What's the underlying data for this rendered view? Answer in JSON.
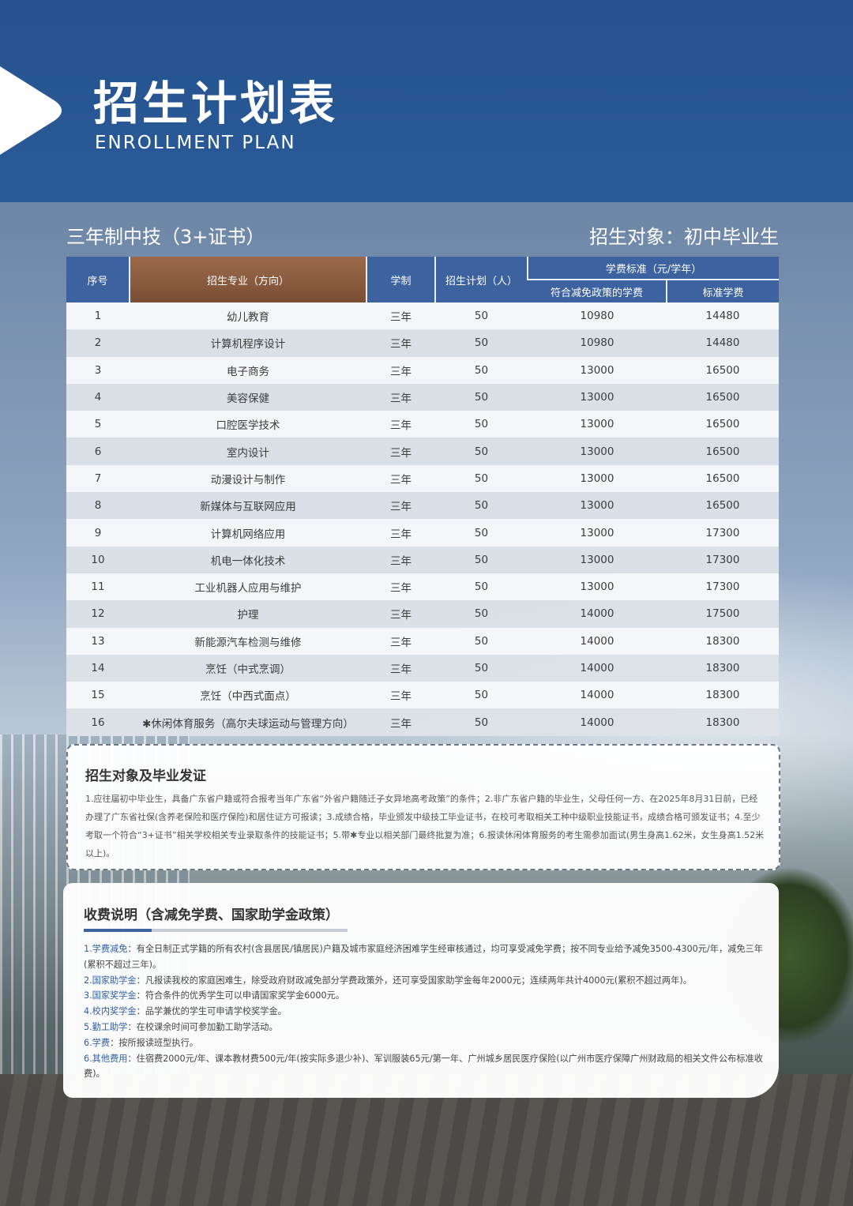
{
  "header": {
    "title_cn": "招生计划表",
    "title_en": "ENROLLMENT PLAN"
  },
  "subtitle": {
    "program": "三年制中技（3+证书）",
    "target": "招生对象：初中毕业生"
  },
  "table": {
    "headers": {
      "no": "序号",
      "major": "招生专业（方向）",
      "duration": "学制",
      "quota": "招生计划（人）",
      "fee_group": "学费标准（元/学年）",
      "fee_reduced": "符合减免政策的学费",
      "fee_standard": "标准学费"
    },
    "rows": [
      {
        "no": "1",
        "major": "幼儿教育",
        "duration": "三年",
        "quota": "50",
        "fee_reduced": "10980",
        "fee_standard": "14480"
      },
      {
        "no": "2",
        "major": "计算机程序设计",
        "duration": "三年",
        "quota": "50",
        "fee_reduced": "10980",
        "fee_standard": "14480"
      },
      {
        "no": "3",
        "major": "电子商务",
        "duration": "三年",
        "quota": "50",
        "fee_reduced": "13000",
        "fee_standard": "16500"
      },
      {
        "no": "4",
        "major": "美容保健",
        "duration": "三年",
        "quota": "50",
        "fee_reduced": "13000",
        "fee_standard": "16500"
      },
      {
        "no": "5",
        "major": "口腔医学技术",
        "duration": "三年",
        "quota": "50",
        "fee_reduced": "13000",
        "fee_standard": "16500"
      },
      {
        "no": "6",
        "major": "室内设计",
        "duration": "三年",
        "quota": "50",
        "fee_reduced": "13000",
        "fee_standard": "16500"
      },
      {
        "no": "7",
        "major": "动漫设计与制作",
        "duration": "三年",
        "quota": "50",
        "fee_reduced": "13000",
        "fee_standard": "16500"
      },
      {
        "no": "8",
        "major": "新媒体与互联网应用",
        "duration": "三年",
        "quota": "50",
        "fee_reduced": "13000",
        "fee_standard": "16500"
      },
      {
        "no": "9",
        "major": "计算机网络应用",
        "duration": "三年",
        "quota": "50",
        "fee_reduced": "13000",
        "fee_standard": "17300"
      },
      {
        "no": "10",
        "major": "机电一体化技术",
        "duration": "三年",
        "quota": "50",
        "fee_reduced": "13000",
        "fee_standard": "17300"
      },
      {
        "no": "11",
        "major": "工业机器人应用与维护",
        "duration": "三年",
        "quota": "50",
        "fee_reduced": "13000",
        "fee_standard": "17300"
      },
      {
        "no": "12",
        "major": "护理",
        "duration": "三年",
        "quota": "50",
        "fee_reduced": "14000",
        "fee_standard": "17500"
      },
      {
        "no": "13",
        "major": "新能源汽车检测与维修",
        "duration": "三年",
        "quota": "50",
        "fee_reduced": "14000",
        "fee_standard": "18300"
      },
      {
        "no": "14",
        "major": "烹饪（中式烹调）",
        "duration": "三年",
        "quota": "50",
        "fee_reduced": "14000",
        "fee_standard": "18300"
      },
      {
        "no": "15",
        "major": "烹饪（中西式面点）",
        "duration": "三年",
        "quota": "50",
        "fee_reduced": "14000",
        "fee_standard": "18300"
      },
      {
        "no": "16",
        "major": "✱休闲体育服务（高尔夫球运动与管理方向）",
        "duration": "三年",
        "quota": "50",
        "fee_reduced": "14000",
        "fee_standard": "18300"
      }
    ]
  },
  "requirements": {
    "title": "招生对象及毕业发证",
    "text": "1.应往届初中毕业生，具备广东省户籍或符合报考当年广东省“外省户籍随迁子女异地高考政策”的条件；2.非广东省户籍的毕业生，父母任何一方、在2025年8月31日前，已经办理了广东省社保(含养老保险和医疗保险)和居住证方可报读；3.成绩合格，毕业颁发中级技工毕业证书，在校可考取相关工种中级职业技能证书，成绩合格可颁发证书；4.至少考取一个符合“3+证书”相关学校相关专业录取条件的技能证书；5.带✱专业以相关部门最终批复为准；6.报读休闲体育服务的考生需参加面试(男生身高1.62米，女生身高1.52米以上)。"
  },
  "fees": {
    "title": "收费说明（含减免学费、国家助学金政策）",
    "items": [
      {
        "key": "1.学费减免",
        "text": "：有全日制正式学籍的所有农村(含县居民/镇居民)户籍及城市家庭经济困难学生经审核通过，均可享受减免学费；按不同专业给予减免3500-4300元/年，减免三年(累积不超过三年)。"
      },
      {
        "key": "2.国家助学金",
        "text": "：凡报读我校的家庭困难生，除受政府财政减免部分学费政策外，还可享受国家助学金每年2000元；连续两年共计4000元(累积不超过两年)。"
      },
      {
        "key": "3.国家奖学金",
        "text": "：符合条件的优秀学生可以申请国家奖学金6000元。"
      },
      {
        "key": "4.校内奖学金",
        "text": "：品学兼优的学生可申请学校奖学金。"
      },
      {
        "key": "5.勤工助学",
        "text": "：在校课余时间可参加勤工助学活动。"
      },
      {
        "key": "6.学费",
        "text": "：按所报读班型执行。"
      },
      {
        "key": "6.其他费用",
        "text": "：住宿费2000元/年、课本教材费500元/年(按实际多退少补)、军训服装65元/第一年、广州城乡居民医疗保险(以广州市医疗保障广州财政局的相关文件公布标准收费)。"
      }
    ]
  }
}
